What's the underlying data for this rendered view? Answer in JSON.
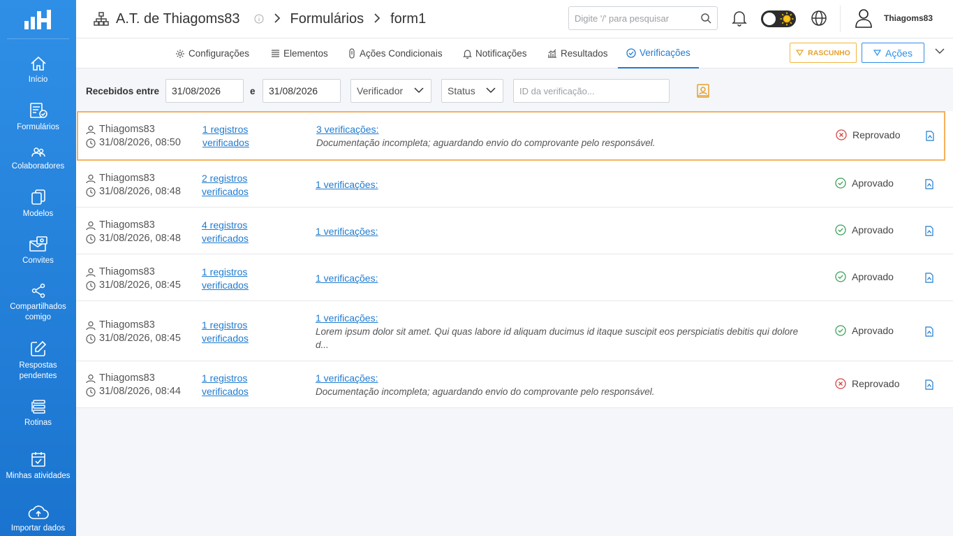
{
  "sidebar": {
    "items": [
      {
        "label": "Início",
        "icon": "home-icon"
      },
      {
        "label": "Formulários",
        "icon": "forms-icon"
      },
      {
        "label": "Colaboradores",
        "icon": "users-icon"
      },
      {
        "label": "Modelos",
        "icon": "templates-icon"
      },
      {
        "label": "Convites",
        "icon": "invites-icon"
      },
      {
        "label": "Compartilhados comigo",
        "icon": "share-icon"
      },
      {
        "label": "Respostas pendentes",
        "icon": "edit-icon"
      },
      {
        "label": "Rotinas",
        "icon": "routines-icon"
      },
      {
        "label": "Minhas atividades",
        "icon": "calendar-check-icon"
      },
      {
        "label": "Importar dados",
        "icon": "cloud-upload-icon"
      }
    ]
  },
  "header": {
    "org": "A.T. de Thiagoms83",
    "section": "Formulários",
    "form": "form1",
    "search_placeholder": "Digite '/' para pesquisar",
    "username": "Thiagoms83"
  },
  "tabs": [
    {
      "label": "Configurações",
      "icon": "gear-icon"
    },
    {
      "label": "Elementos",
      "icon": "list-icon"
    },
    {
      "label": "Ações Condicionais",
      "icon": "condition-icon"
    },
    {
      "label": "Notificações",
      "icon": "bell-icon"
    },
    {
      "label": "Resultados",
      "icon": "chart-icon"
    },
    {
      "label": "Verificações",
      "icon": "check-circle-icon",
      "active": true
    }
  ],
  "toolbar": {
    "draft_label": "RASCUNHO",
    "actions_label": "Ações"
  },
  "filters": {
    "received_label": "Recebidos entre",
    "date_from": "31/08/2026",
    "and_label": "e",
    "date_to": "31/08/2026",
    "verifier_label": "Verificador",
    "status_label": "Status",
    "id_placeholder": "ID da verificação..."
  },
  "rows": [
    {
      "user": "Thiagoms83",
      "datetime": "31/08/2026, 08:50",
      "reg1": "1 registros",
      "reg2": "verificados",
      "verifications": "3 verificações:",
      "note": "Documentação incompleta; aguardando envio do comprovante pelo responsável.",
      "status": "Reprovado"
    },
    {
      "user": "Thiagoms83",
      "datetime": "31/08/2026, 08:48",
      "reg1": "2 registros",
      "reg2": "verificados",
      "verifications": "1 verificações:",
      "note": "",
      "status": "Aprovado"
    },
    {
      "user": "Thiagoms83",
      "datetime": "31/08/2026, 08:48",
      "reg1": "4 registros",
      "reg2": "verificados",
      "verifications": "1 verificações:",
      "note": "",
      "status": "Aprovado"
    },
    {
      "user": "Thiagoms83",
      "datetime": "31/08/2026, 08:45",
      "reg1": "1 registros",
      "reg2": "verificados",
      "verifications": "1 verificações:",
      "note": "",
      "status": "Aprovado"
    },
    {
      "user": "Thiagoms83",
      "datetime": "31/08/2026, 08:45",
      "reg1": "1 registros",
      "reg2": "verificados",
      "verifications": "1 verificações:",
      "note": "Lorem ipsum dolor sit amet. Qui quas labore id aliquam ducimus id itaque suscipit eos perspiciatis debitis qui dolore d...",
      "status": "Aprovado"
    },
    {
      "user": "Thiagoms83",
      "datetime": "31/08/2026, 08:44",
      "reg1": "1 registros",
      "reg2": "verificados",
      "verifications": "1 verificações:",
      "note": "Documentação incompleta; aguardando envio do comprovante pelo responsável.",
      "status": "Reprovado"
    }
  ],
  "colors": {
    "primary": "#1f7bd0",
    "approved": "#3aa35b",
    "rejected": "#d64545",
    "draft": "#e7a12b"
  }
}
